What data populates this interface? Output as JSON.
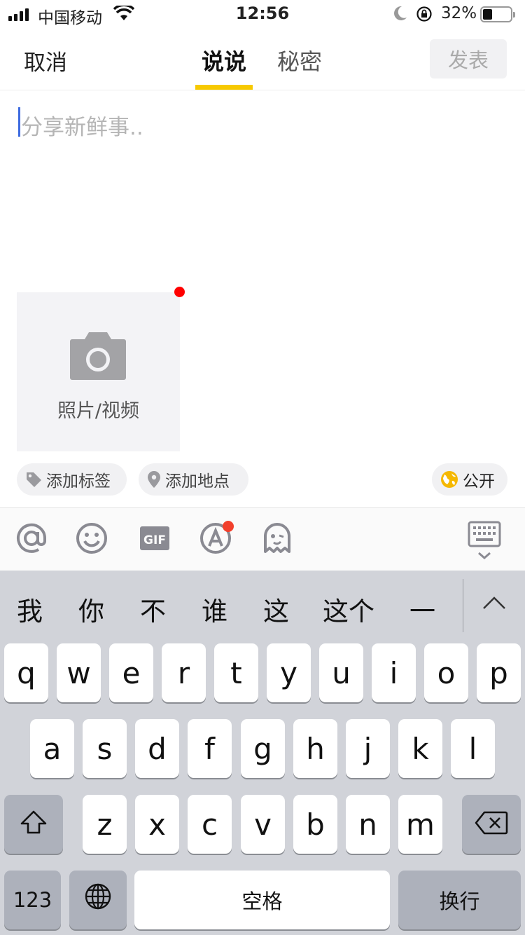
{
  "status_bar": {
    "carrier": "中国移动",
    "time": "12:56",
    "battery_percent": "32%",
    "battery_level": 0.32
  },
  "nav": {
    "cancel": "取消",
    "tabs": [
      "说说",
      "秘密"
    ],
    "active_tab": 0,
    "publish": "发表"
  },
  "compose": {
    "placeholder": "分享新鲜事.."
  },
  "media": {
    "label": "照片/视频"
  },
  "chips": {
    "tag": "添加标签",
    "location": "添加地点",
    "visibility": "公开"
  },
  "toolbar": {
    "icons": [
      "at-icon",
      "emoji-icon",
      "gif-icon",
      "font-style-icon",
      "ghost-sticker-icon",
      "keyboard-hide-icon"
    ]
  },
  "keyboard": {
    "candidates": [
      "我",
      "你",
      "不",
      "谁",
      "这",
      "这个",
      "一"
    ],
    "row1": [
      "q",
      "w",
      "e",
      "r",
      "t",
      "y",
      "u",
      "i",
      "o",
      "p"
    ],
    "row2": [
      "a",
      "s",
      "d",
      "f",
      "g",
      "h",
      "j",
      "k",
      "l"
    ],
    "row3": [
      "z",
      "x",
      "c",
      "v",
      "b",
      "n",
      "m"
    ],
    "numbers": "123",
    "space": "空格",
    "return": "换行"
  },
  "colors": {
    "accent": "#f7c900",
    "caret": "#3d6be0",
    "dot": "#ff0000",
    "keyboard_bg": "#d1d3d9"
  }
}
